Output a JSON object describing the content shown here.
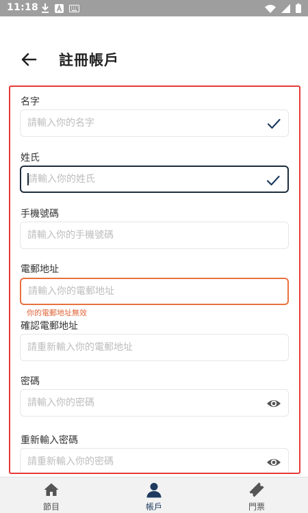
{
  "status_bar": {
    "time": "11:18"
  },
  "header": {
    "title": "註冊帳戶"
  },
  "form": {
    "fields": [
      {
        "label": "名字",
        "placeholder": "請輸入你的名字",
        "trailing_icon": "check-icon"
      },
      {
        "label": "姓氏",
        "placeholder": "請輸入你的姓氏",
        "trailing_icon": "check-icon",
        "state": "focused"
      },
      {
        "label": "手機號碼",
        "placeholder": "請輸入你的手機號碼"
      },
      {
        "label": "電郵地址",
        "placeholder": "請輸入你的電郵地址",
        "state": "error",
        "error": "你的電郵地址無效"
      },
      {
        "label": "確認電郵地址",
        "placeholder": "請重新輸入你的電郵地址"
      },
      {
        "label": "密碼",
        "placeholder": "請輸入你的密碼",
        "trailing_icon": "eye-icon"
      },
      {
        "label": "重新輸入密碼",
        "placeholder": "請重新輸入你的密碼",
        "trailing_icon": "eye-icon"
      }
    ]
  },
  "bottom_nav": {
    "items": [
      {
        "label": "節目",
        "icon": "home-icon"
      },
      {
        "label": "帳戶",
        "icon": "account-icon",
        "active": true
      },
      {
        "label": "門票",
        "icon": "ticket-icon"
      }
    ]
  },
  "colors": {
    "accent": "#1e3a5f",
    "error": "#e8703e",
    "frame_border": "#e53935",
    "status_bar": "#9e9e9e"
  }
}
